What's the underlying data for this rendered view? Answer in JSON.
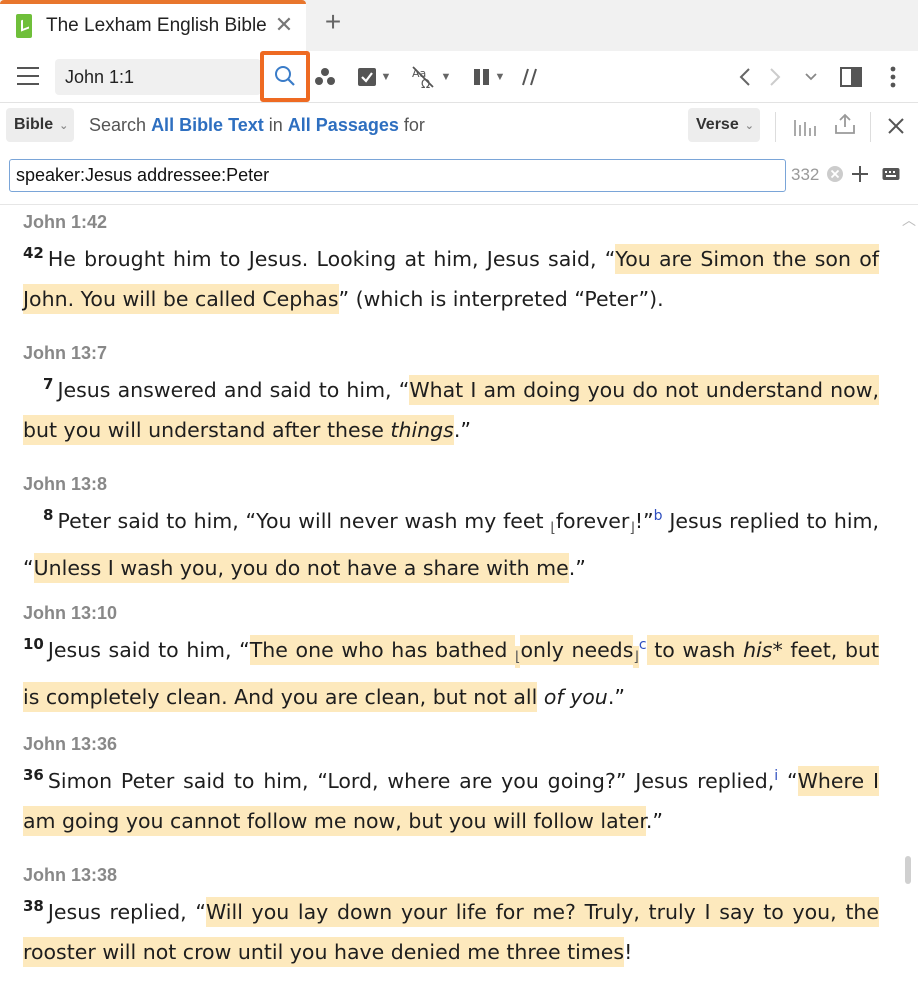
{
  "tab": {
    "title": "The Lexham English Bible",
    "close": "✕",
    "add": "+"
  },
  "toolbar": {
    "reference": "John 1:1"
  },
  "search": {
    "type": "Bible",
    "label_search": "Search",
    "scope_text": "All Bible Text",
    "label_in": "in",
    "scope_passages": "All Passages",
    "label_for": "for",
    "match": "Verse",
    "query": "speaker:Jesus addressee:Peter",
    "count": "332"
  },
  "results": [
    {
      "ref": "John 1:42",
      "num": "42",
      "parts": [
        {
          "t": "He brought him to Jesus. Looking at him, Jesus said, “"
        },
        {
          "t": "You are Simon the son of John. You will be called Cephas",
          "h": true
        },
        {
          "t": "” (which is interpreted “Peter”)."
        }
      ]
    },
    {
      "ref": "John 13:7",
      "num": "7",
      "parts": [
        {
          "t": "Jesus answered and said to him, “"
        },
        {
          "t": "What I am doing you do not understand now, but you will understand after these ",
          "h": true
        },
        {
          "t": "things",
          "h": true,
          "i": true
        },
        {
          "t": ".”"
        }
      ]
    },
    {
      "ref": "John 13:8",
      "num": "8",
      "parts": [
        {
          "t": "Peter said to him, “You will never wash my feet "
        },
        {
          "t": "⌊",
          "half": true
        },
        {
          "t": "forever"
        },
        {
          "t": "⌋",
          "half": true
        },
        {
          "t": "!”"
        },
        {
          "t": "b",
          "fn": true
        },
        {
          "t": " Jesus replied to him, “"
        },
        {
          "t": "Unless I wash you, you do not have a share with me",
          "h": true
        },
        {
          "t": ".”"
        }
      ]
    },
    {
      "ref": "John 13:10",
      "num": "10",
      "parts": [
        {
          "t": "Jesus said to him, “"
        },
        {
          "t": "The one who has bathed ",
          "h": true
        },
        {
          "t": "⌊",
          "half": true,
          "h": true
        },
        {
          "t": "only needs",
          "h": true
        },
        {
          "t": "⌋",
          "half": true,
          "h": true
        },
        {
          "t": "c",
          "fn": true
        },
        {
          "t": " to wash ",
          "h": true
        },
        {
          "t": "his",
          "h": true,
          "i": true
        },
        {
          "t": "* feet, but is completely clean. And you are clean, but not all",
          "h": true
        },
        {
          "t": " "
        },
        {
          "t": "of you",
          "i": true
        },
        {
          "t": ".”"
        }
      ]
    },
    {
      "ref": "John 13:36",
      "num": "36",
      "parts": [
        {
          "t": "Simon Peter said to him, “Lord, where are you going?” Jesus replied,"
        },
        {
          "t": "i",
          "fn": true
        },
        {
          "t": " “"
        },
        {
          "t": "Where I am going you cannot follow me now, but you will follow later",
          "h": true
        },
        {
          "t": ".”"
        }
      ]
    },
    {
      "ref": "John 13:38",
      "num": "38",
      "parts": [
        {
          "t": "Jesus replied, “"
        },
        {
          "t": "Will you lay down your life for me? Truly, truly I say to you, the rooster will not crow until you have denied me three times",
          "h": true
        },
        {
          "t": "!"
        }
      ]
    }
  ]
}
